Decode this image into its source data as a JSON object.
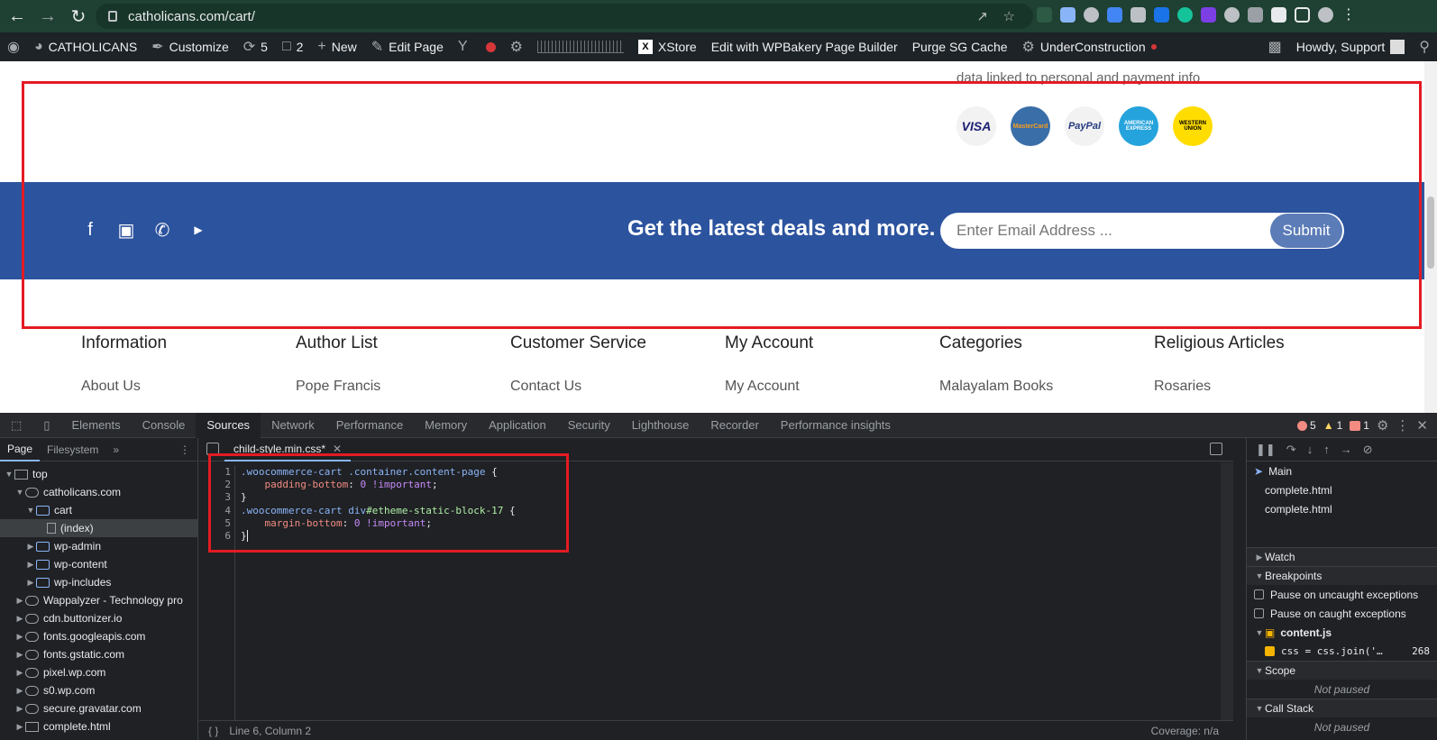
{
  "browser": {
    "url": "catholicans.com/cart/"
  },
  "wpbar": {
    "site": "CATHOLICANS",
    "customize": "Customize",
    "updates": "5",
    "comments": "2",
    "new": "New",
    "edit_page": "Edit Page",
    "xstore": "XStore",
    "wpbakery": "Edit with WPBakery Page Builder",
    "purge": "Purge SG Cache",
    "under_construction": "UnderConstruction",
    "howdy": "Howdy, Support"
  },
  "page": {
    "top_text": "data linked to personal and payment info",
    "payments": [
      "VISA",
      "MasterCard",
      "PayPal",
      "AMERICAN EXPRESS",
      "WESTERN UNION"
    ],
    "newsletter_title": "Get the latest deals and more.",
    "email_placeholder": "Enter Email Address ...",
    "submit": "Submit",
    "footer": [
      {
        "heading": "Information",
        "link": "About Us"
      },
      {
        "heading": "Author List",
        "link": "Pope Francis"
      },
      {
        "heading": "Customer Service",
        "link": "Contact Us"
      },
      {
        "heading": "My Account",
        "link": "My Account"
      },
      {
        "heading": "Categories",
        "link": "Malayalam Books"
      },
      {
        "heading": "Religious Articles",
        "link": "Rosaries"
      }
    ]
  },
  "devtools": {
    "tabs": [
      "Elements",
      "Console",
      "Sources",
      "Network",
      "Performance",
      "Memory",
      "Application",
      "Security",
      "Lighthouse",
      "Recorder",
      "Performance insights"
    ],
    "errors": "5",
    "warnings": "1",
    "issues": "1",
    "nav_tabs": [
      "Page",
      "Filesystem"
    ],
    "tree": [
      "top",
      "catholicans.com",
      "cart",
      "(index)",
      "wp-admin",
      "wp-content",
      "wp-includes",
      "Wappalyzer - Technology pro",
      "cdn.buttonizer.io",
      "fonts.googleapis.com",
      "fonts.gstatic.com",
      "pixel.wp.com",
      "s0.wp.com",
      "secure.gravatar.com",
      "complete.html"
    ],
    "file_tab": "child-style.min.css*",
    "line_numbers": [
      "1",
      "2",
      "3",
      "4",
      "5",
      "6"
    ],
    "code": {
      "l1_sel": ".woocommerce-cart .container.content-page",
      "l1_brace": " {",
      "l2_prop": "    padding-bottom",
      "l2_colon": ": ",
      "l2_num": "0",
      "l2_imp": " !important",
      "l2_end": ";",
      "l3": "}",
      "l4_sel": ".woocommerce-cart div",
      "l4_id": "#etheme-static-block-17",
      "l4_brace": " {",
      "l5_prop": "    margin-bottom",
      "l5_colon": ": ",
      "l5_num": "0",
      "l5_imp": " !important",
      "l5_end": ";",
      "l6": "}"
    },
    "status": "Line 6, Column 2",
    "coverage": "Coverage: n/a",
    "debug": {
      "threads_main": "Main",
      "threads": [
        "complete.html",
        "complete.html"
      ],
      "watch": "Watch",
      "breakpoints": "Breakpoints",
      "pause_uncaught": "Pause on uncaught exceptions",
      "pause_caught": "Pause on caught exceptions",
      "bp_file": "content.js",
      "bp_code": "css = css.join('…",
      "bp_line": "268",
      "scope": "Scope",
      "not_paused": "Not paused",
      "call_stack": "Call Stack",
      "not_paused2": "Not paused"
    }
  }
}
